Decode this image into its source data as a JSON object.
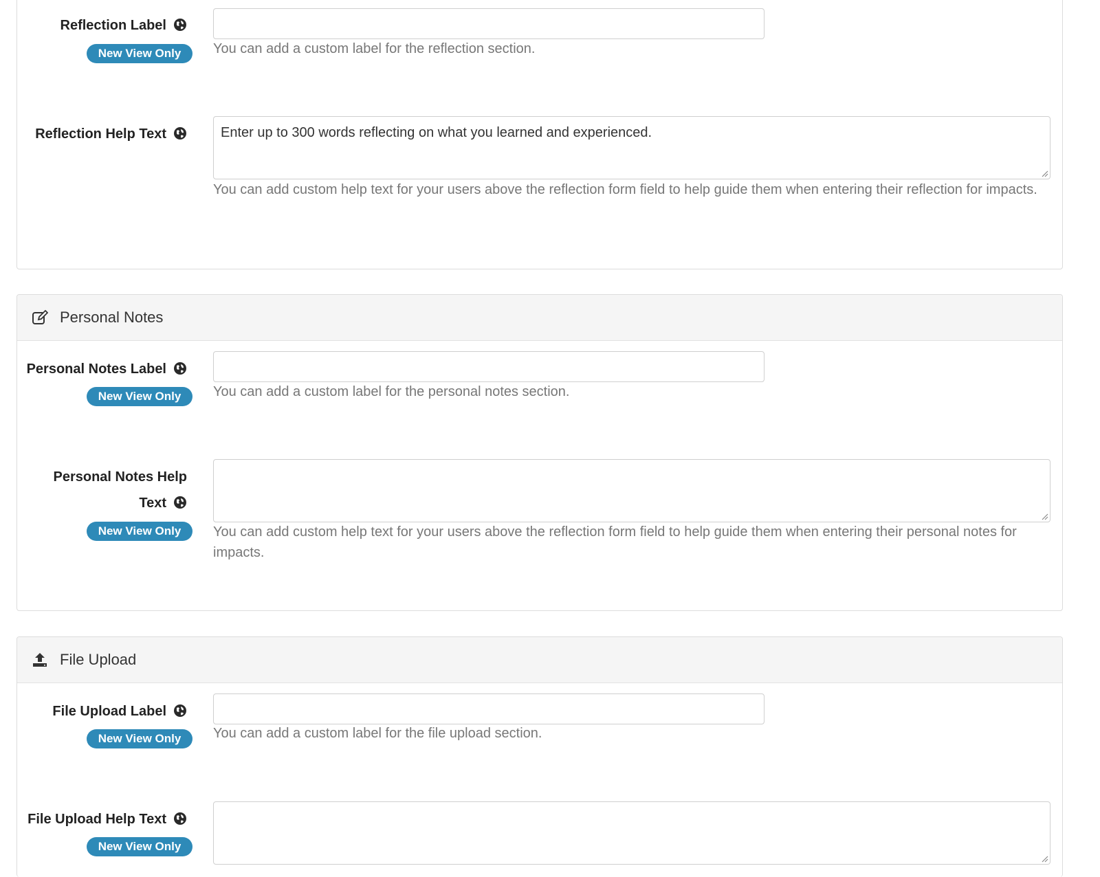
{
  "badge_text": "New View Only",
  "reflection": {
    "label_field": {
      "label": "Reflection Label",
      "value": "",
      "help": "You can add a custom label for the reflection section."
    },
    "help_field": {
      "label": "Reflection Help Text",
      "value": "Enter up to 300 words reflecting on what you learned and experienced.",
      "help": "You can add custom help text for your users above the reflection form field to help guide them when entering their reflection for impacts."
    }
  },
  "personal_notes": {
    "title": "Personal Notes",
    "icon": "edit-icon",
    "label_field": {
      "label": "Personal Notes Label",
      "value": "",
      "help": "You can add a custom label for the personal notes section."
    },
    "help_field": {
      "label_line1": "Personal Notes Help",
      "label_line2": "Text",
      "value": "",
      "help": "You can add custom help text for your users above the reflection form field to help guide them when entering their personal notes for impacts."
    }
  },
  "file_upload": {
    "title": "File Upload",
    "icon": "upload-icon",
    "label_field": {
      "label": "File Upload Label",
      "value": "",
      "help": "You can add a custom label for the file upload section."
    },
    "help_field": {
      "label": "File Upload Help Text",
      "value": ""
    }
  },
  "colors": {
    "badge": "#2e8ab8",
    "heading_bg": "#f5f5f5",
    "help_text": "#777777"
  }
}
